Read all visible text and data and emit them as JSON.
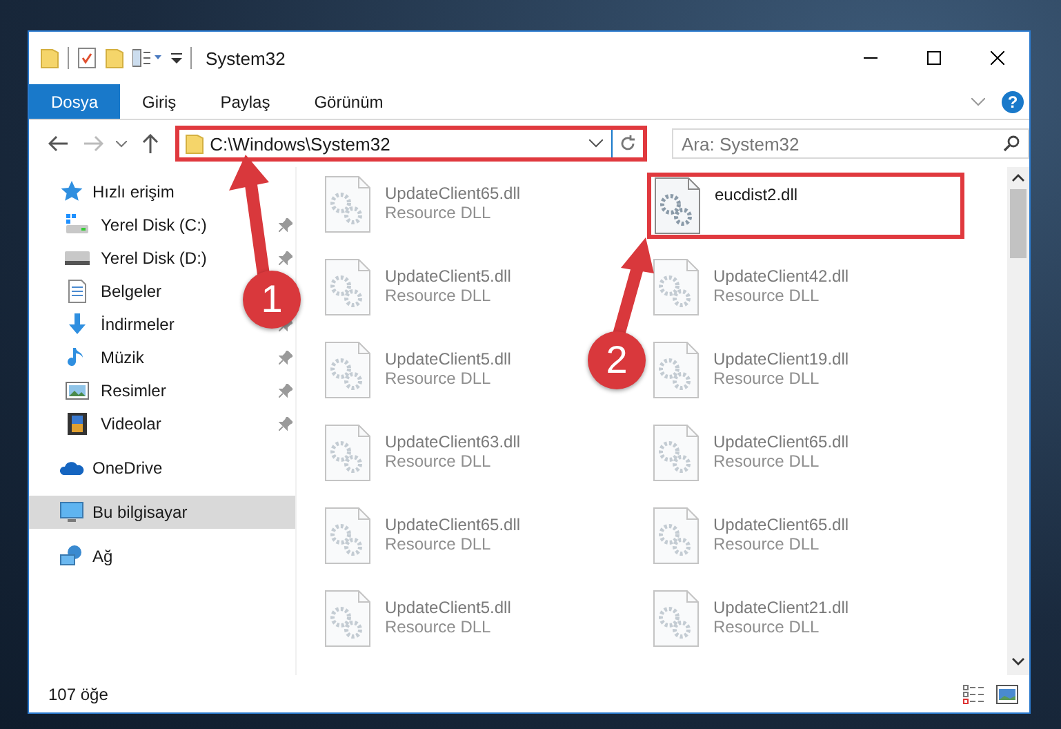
{
  "window": {
    "title": "System32"
  },
  "ribbon": {
    "tabs": [
      {
        "label": "Dosya",
        "selected": true
      },
      {
        "label": "Giriş",
        "selected": false
      },
      {
        "label": "Paylaş",
        "selected": false
      },
      {
        "label": "Görünüm",
        "selected": false
      }
    ],
    "help": "?"
  },
  "address": {
    "path": "C:\\Windows\\System32",
    "highlighted": true
  },
  "search": {
    "placeholder": "Ara: System32"
  },
  "sidebar": {
    "items": [
      {
        "label": "Hızlı erişim",
        "kind": "star",
        "selected": false,
        "children": [
          {
            "label": "Yerel Disk (C:)",
            "kind": "system-drive",
            "pinned": true,
            "selected": false
          },
          {
            "label": "Yerel Disk (D:)",
            "kind": "drive",
            "pinned": true,
            "selected": false
          },
          {
            "label": "Belgeler",
            "kind": "documents",
            "pinned": false,
            "selected": false
          },
          {
            "label": "İndirmeler",
            "kind": "downloads",
            "pinned": true,
            "selected": false
          },
          {
            "label": "Müzik",
            "kind": "music",
            "pinned": true,
            "selected": false
          },
          {
            "label": "Resimler",
            "kind": "pictures",
            "pinned": true,
            "selected": false
          },
          {
            "label": "Videolar",
            "kind": "videos",
            "pinned": true,
            "selected": false
          }
        ]
      },
      {
        "label": "OneDrive",
        "kind": "cloud",
        "selected": false
      },
      {
        "label": "Bu bilgisayar",
        "kind": "computer",
        "selected": true
      },
      {
        "label": "Ağ",
        "kind": "network",
        "selected": false
      }
    ]
  },
  "files": [
    {
      "name": "UpdateClient65.dll",
      "type": "Resource DLL",
      "blurred": true,
      "highlighted": false
    },
    {
      "name": "eucdist2.dll",
      "blurred": false,
      "highlighted": true
    },
    {
      "name": "UpdateClient5.dll",
      "type": "Resource DLL",
      "blurred": true,
      "highlighted": false
    },
    {
      "name": "UpdateClient42.dll",
      "type": "Resource DLL",
      "blurred": true,
      "highlighted": false
    },
    {
      "name": "UpdateClient5.dll",
      "type": "Resource DLL",
      "blurred": true,
      "highlighted": false
    },
    {
      "name": "UpdateClient19.dll",
      "type": "Resource DLL",
      "blurred": true,
      "highlighted": false
    },
    {
      "name": "UpdateClient63.dll",
      "type": "Resource DLL",
      "blurred": true,
      "highlighted": false
    },
    {
      "name": "UpdateClient65.dll",
      "type": "Resource DLL",
      "blurred": true,
      "highlighted": false
    },
    {
      "name": "UpdateClient65.dll",
      "type": "Resource DLL",
      "blurred": true,
      "highlighted": false
    },
    {
      "name": "UpdateClient65.dll",
      "type": "Resource DLL",
      "blurred": true,
      "highlighted": false
    },
    {
      "name": "UpdateClient5.dll",
      "type": "Resource DLL",
      "blurred": true,
      "highlighted": false
    },
    {
      "name": "UpdateClient21.dll",
      "type": "Resource DLL",
      "blurred": true,
      "highlighted": false
    }
  ],
  "status_bar": {
    "count": "107 öğe"
  },
  "annotations": [
    {
      "number": "1"
    },
    {
      "number": "2"
    }
  ]
}
